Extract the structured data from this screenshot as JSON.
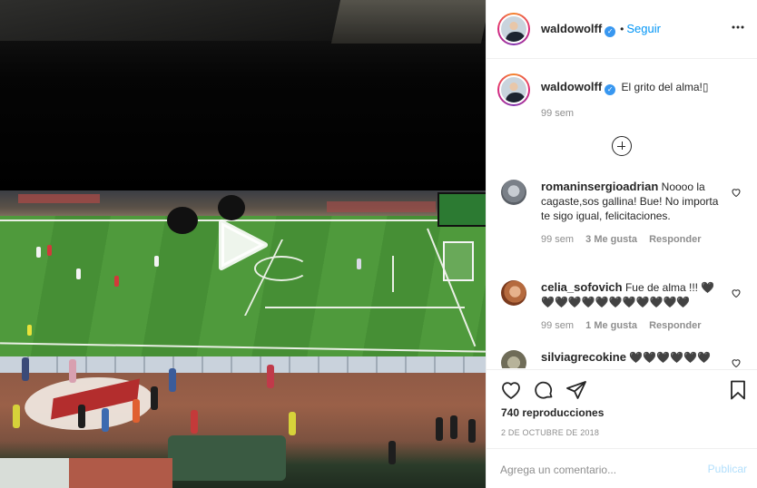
{
  "header": {
    "username": "waldowolff",
    "verified_icon": "verified-badge-icon",
    "separator": "•",
    "follow_label": "Seguir",
    "more_icon": "more-options-icon"
  },
  "caption": {
    "username": "waldowolff",
    "text": "El grito del alma!▯",
    "time": "99 sem"
  },
  "load_more_icon": "plus-circle-icon",
  "comments": [
    {
      "username": "romaninsergioadrian",
      "text": "Noooo la cagaste,sos gallina! Bue! No importa te sigo igual, felicitaciones.",
      "time": "99 sem",
      "likes": "3 Me gusta",
      "reply": "Responder"
    },
    {
      "username": "celia_sofovich",
      "text": "Fue de alma !!! 🖤🖤🖤🖤🖤🖤🖤🖤🖤🖤🖤🖤",
      "time": "99 sem",
      "likes": "1 Me gusta",
      "reply": "Responder"
    },
    {
      "username": "silviagrecokine",
      "text": "🖤🖤🖤🖤🖤🖤"
    }
  ],
  "actions": {
    "views": "740 reproducciones",
    "date": "2 DE OCTUBRE DE 2018"
  },
  "add_comment": {
    "placeholder": "Agrega un comentario...",
    "publish_label": "Publicar"
  },
  "colors": {
    "accent": "#0095f6",
    "publish_disabled": "#b2dffc",
    "muted": "#8e8e8e",
    "text": "#262626",
    "border": "#efefef"
  }
}
